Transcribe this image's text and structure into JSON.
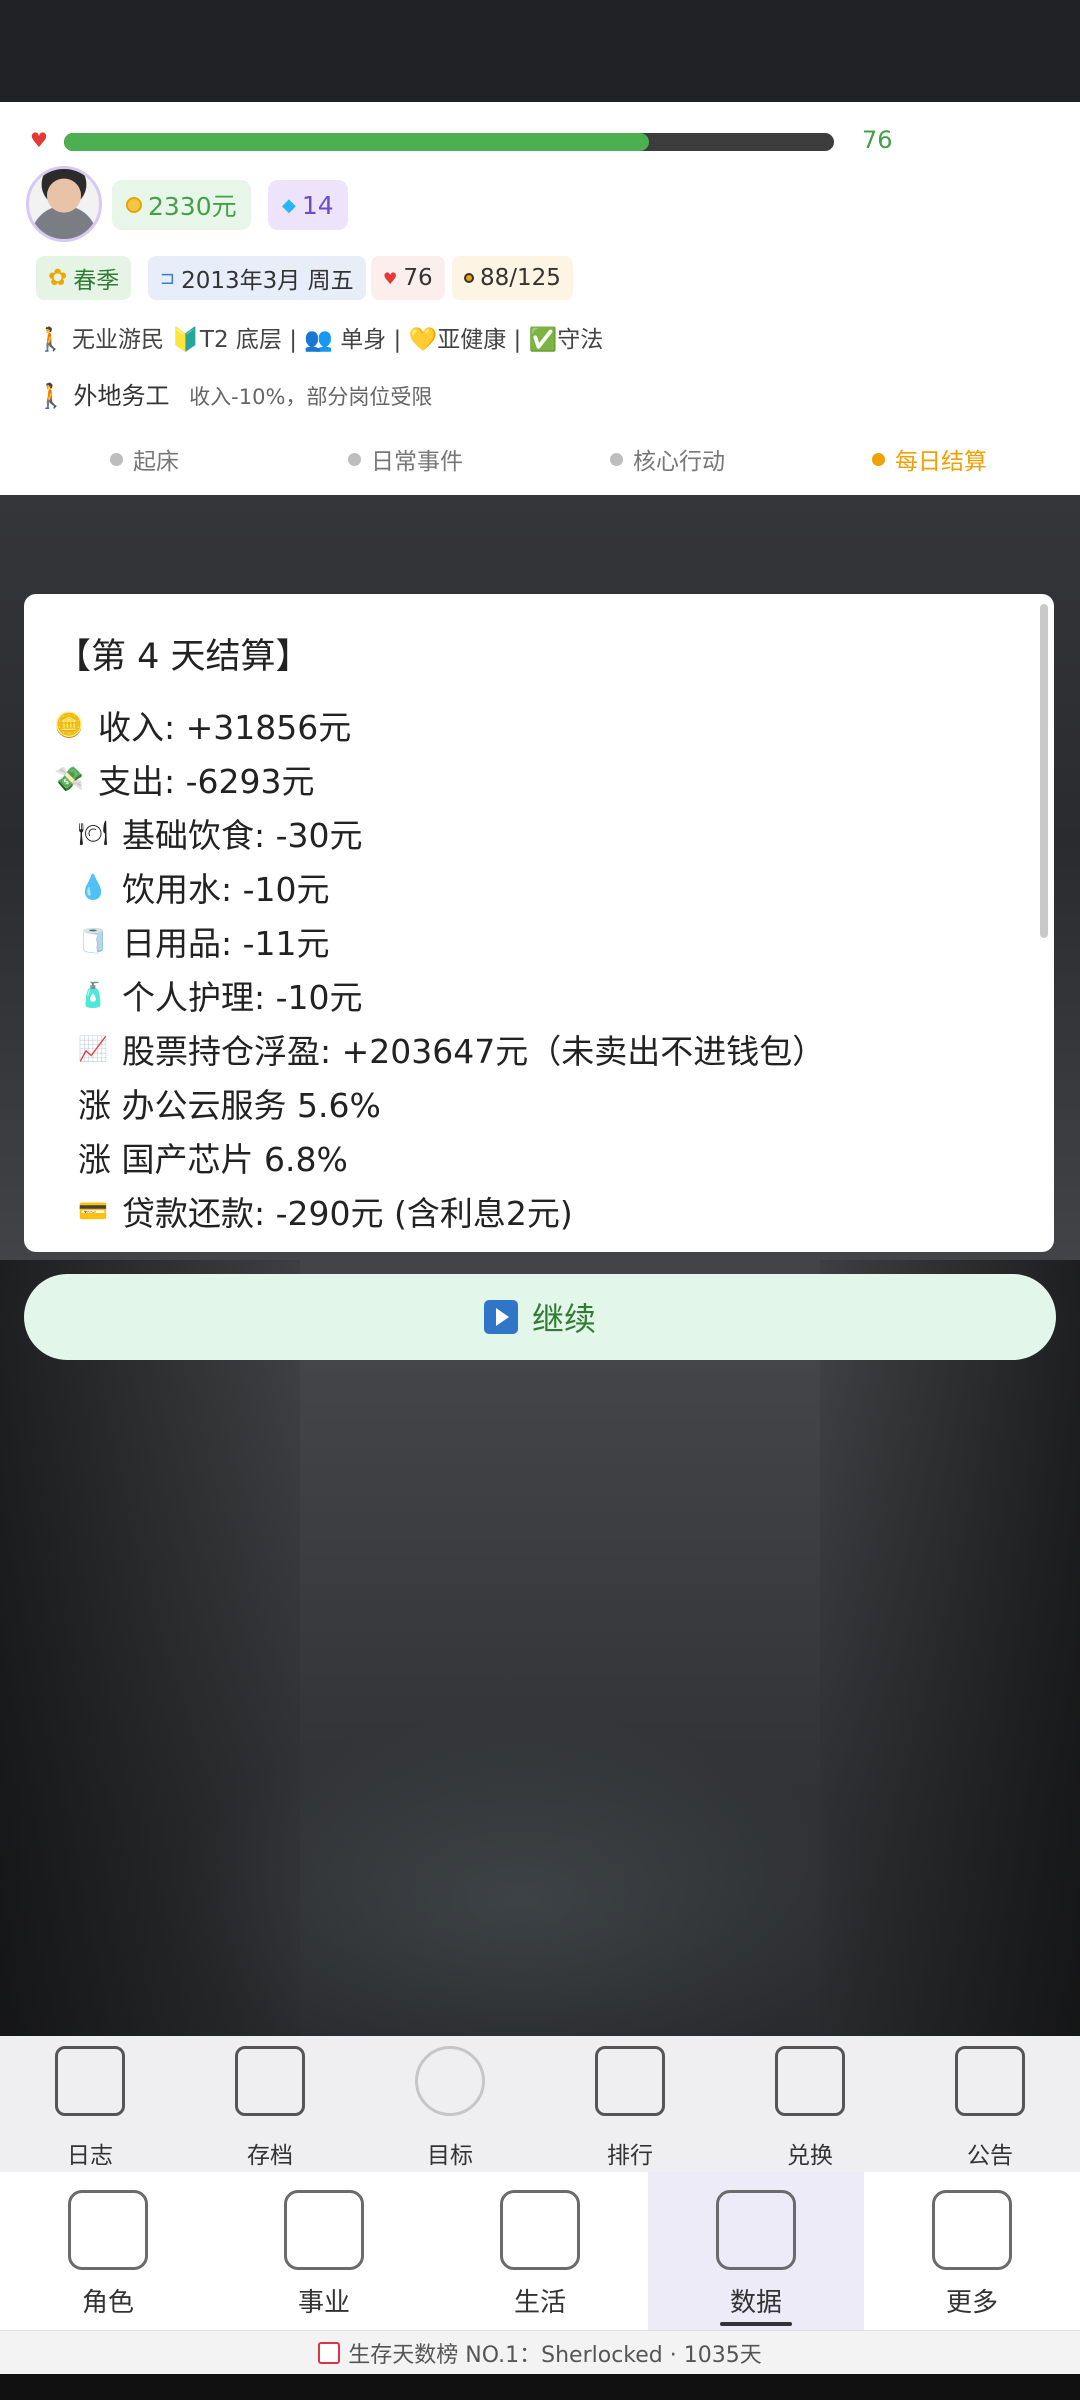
{
  "player": {
    "hp": 76,
    "hp_max": 100,
    "coins": "2330元",
    "gems": "14"
  },
  "tags": {
    "season": "春季",
    "date": "2013年3月 周五",
    "hp": "76",
    "energy": "88/125"
  },
  "status_line": "无业游民 🔰T2 底层 | 👥 单身 | 💛亚健康 | ✅守法",
  "region": {
    "label": "外地务工",
    "desc": "收入-10%，部分岗位受限"
  },
  "steps": [
    {
      "label": "起床"
    },
    {
      "label": "日常事件"
    },
    {
      "label": "核心行动"
    },
    {
      "label": "每日结算"
    }
  ],
  "settlement": {
    "title": "【第 4 天结算】",
    "lines": [
      {
        "icon": "🪙",
        "icon_name": "coin-icon",
        "text": "收入: +31856元"
      },
      {
        "icon": "💸",
        "icon_name": "money-out-icon",
        "text": "支出: -6293元"
      },
      {
        "icon": "🍽",
        "icon_name": "plate-icon",
        "text": "基础饮食: -30元"
      },
      {
        "icon": "💧",
        "icon_name": "water-drop-icon",
        "text": "饮用水: -10元"
      },
      {
        "icon": "🧻",
        "icon_name": "tissue-icon",
        "text": "日用品: -11元"
      },
      {
        "icon": "🧴",
        "icon_name": "lotion-icon",
        "text": "个人护理: -10元"
      },
      {
        "icon": "📈",
        "icon_name": "chart-up-icon",
        "text": "股票持仓浮盈: +203647元（未卖出不进钱包）"
      },
      {
        "icon": "",
        "icon_name": "",
        "text": "涨 办公云服务 5.6%"
      },
      {
        "icon": "",
        "icon_name": "",
        "text": "涨 国产芯片 6.8%"
      },
      {
        "icon": "💳",
        "icon_name": "card-icon",
        "text": "贷款还款: -290元 (含利息2元)"
      }
    ]
  },
  "continue_label": "继续",
  "toolbar": [
    {
      "label": "日志",
      "icon": "notebook-icon"
    },
    {
      "label": "存档",
      "icon": "save-disk-icon"
    },
    {
      "label": "目标",
      "icon": "target-icon"
    },
    {
      "label": "排行",
      "icon": "trophy-icon"
    },
    {
      "label": "兑换",
      "icon": "ticket-icon"
    },
    {
      "label": "公告",
      "icon": "megaphone-icon"
    }
  ],
  "nav": [
    {
      "label": "角色",
      "icon": "person-walk-icon"
    },
    {
      "label": "事业",
      "icon": "briefcase-icon"
    },
    {
      "label": "生活",
      "icon": "house-icon"
    },
    {
      "label": "数据",
      "icon": "bar-chart-icon"
    },
    {
      "label": "更多",
      "icon": "calculator-icon"
    }
  ],
  "footer": "生存天数榜 NO.1：Sherlocked · 1035天"
}
